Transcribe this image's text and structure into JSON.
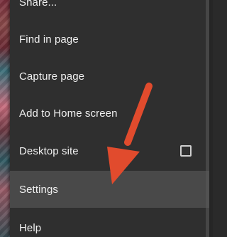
{
  "menu": {
    "items": [
      {
        "label": "Share..."
      },
      {
        "label": "Find in page"
      },
      {
        "label": "Capture page"
      },
      {
        "label": "Add to Home screen"
      },
      {
        "label": "Desktop site",
        "checkbox": false
      },
      {
        "label": "Settings",
        "selected": true
      },
      {
        "label": "Help"
      }
    ]
  },
  "annotation": {
    "arrow_color": "#e14b2d",
    "icon": "red-arrow-icon"
  }
}
